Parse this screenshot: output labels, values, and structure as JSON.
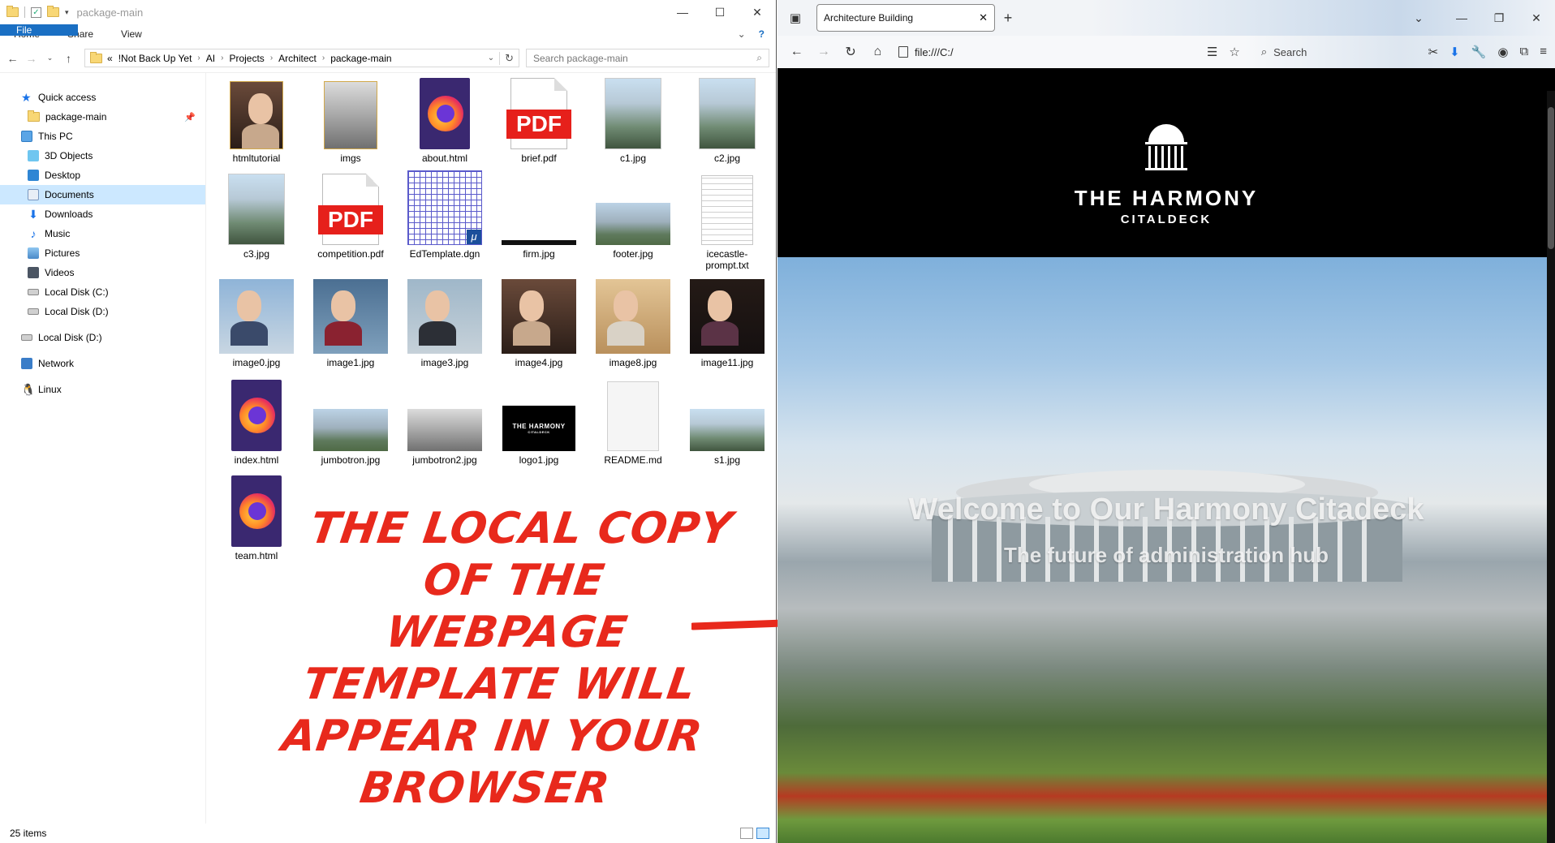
{
  "explorer": {
    "window_title": "package-main",
    "ribbon_tabs": [
      "File",
      "Home",
      "Share",
      "View"
    ],
    "breadcrumb": [
      "«",
      "!Not Back Up Yet",
      "AI",
      "Projects",
      "Architect",
      "package-main"
    ],
    "search_placeholder": "Search package-main",
    "nav": {
      "quick_access": "Quick access",
      "pinned_folder": "package-main",
      "this_pc": "This PC",
      "objects3d": "3D Objects",
      "desktop": "Desktop",
      "documents": "Documents",
      "downloads": "Downloads",
      "music": "Music",
      "pictures": "Pictures",
      "videos": "Videos",
      "disk_c": "Local Disk (C:)",
      "disk_d": "Local Disk (D:)",
      "disk_d2": "Local Disk (D:)",
      "network": "Network",
      "linux": "Linux"
    },
    "files": [
      "htmltutorial",
      "imgs",
      "about.html",
      "brief.pdf",
      "c1.jpg",
      "c2.jpg",
      "c3.jpg",
      "competition.pdf",
      "EdTemplate.dgn",
      "firm.jpg",
      "footer.jpg",
      "icecastle-prompt.txt",
      "image0.jpg",
      "image1.jpg",
      "image3.jpg",
      "image4.jpg",
      "image8.jpg",
      "image11.jpg",
      "index.html",
      "jumbotron.jpg",
      "jumbotron2.jpg",
      "logo1.jpg",
      "README.md",
      "s1.jpg",
      "team.html"
    ],
    "pdf_badge": "PDF",
    "logo_thumb_title": "THE HARMONY",
    "logo_thumb_sub": "CITALDECK",
    "status": "25 items"
  },
  "annotation": {
    "caption": "The local copy of the webpage template will appear in your browser"
  },
  "browser": {
    "tab_title": "Architecture Building",
    "url": "file:///C:/",
    "search_placeholder": "Search",
    "brand_title": "THE HARMONY",
    "brand_subtitle": "CITALDECK",
    "hero_title": "Welcome to Our Harmony Citadeck",
    "hero_subtitle": "The future of administration hub"
  },
  "colors": {
    "accent": "#1a6fc3",
    "annotation_red": "#e8291c",
    "selected_nav": "#cce8ff"
  }
}
